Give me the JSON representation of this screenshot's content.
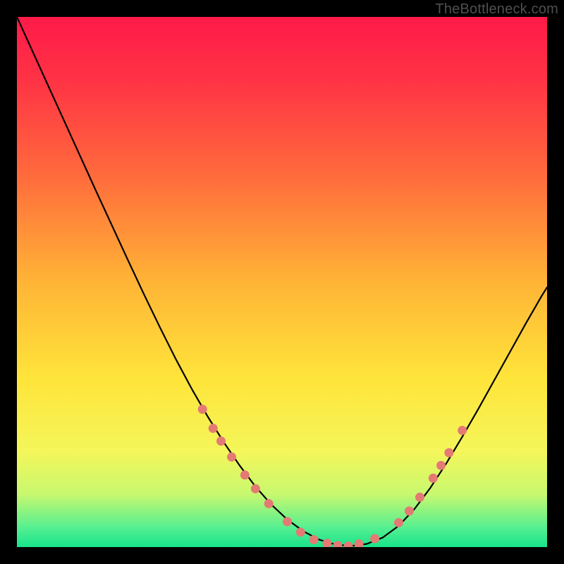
{
  "watermark": "TheBottleneck.com",
  "chart_data": {
    "type": "line",
    "title": "",
    "xlabel": "",
    "ylabel": "",
    "xlim": [
      0,
      100
    ],
    "ylim": [
      0,
      100
    ],
    "grid": false,
    "legend": false,
    "gradient_stops": [
      {
        "offset": 0.0,
        "color": "#ff1a49"
      },
      {
        "offset": 0.12,
        "color": "#ff3345"
      },
      {
        "offset": 0.3,
        "color": "#ff6b3c"
      },
      {
        "offset": 0.5,
        "color": "#ffb436"
      },
      {
        "offset": 0.68,
        "color": "#ffe43a"
      },
      {
        "offset": 0.82,
        "color": "#f4f65a"
      },
      {
        "offset": 0.9,
        "color": "#c8f86f"
      },
      {
        "offset": 0.965,
        "color": "#52ef91"
      },
      {
        "offset": 1.0,
        "color": "#18e38a"
      }
    ],
    "series": [
      {
        "name": "curve",
        "color": "#000000",
        "stroke_width": 2.2,
        "x": [
          0.0,
          3,
          6,
          9,
          12,
          15,
          18,
          21,
          24,
          27,
          30,
          33,
          36,
          39,
          42,
          45,
          48,
          51,
          54,
          57,
          60,
          63,
          66,
          69,
          72,
          75,
          78,
          81,
          84,
          87,
          90,
          93,
          96,
          99,
          100
        ],
        "y": [
          100.0,
          93.4,
          86.8,
          80.2,
          73.6,
          67.0,
          60.5,
          54.0,
          47.6,
          41.4,
          35.4,
          29.8,
          24.6,
          19.8,
          15.4,
          11.4,
          8.0,
          5.2,
          3.0,
          1.4,
          0.5,
          0.2,
          0.6,
          1.8,
          4.0,
          7.2,
          11.2,
          15.8,
          20.8,
          26.0,
          31.4,
          36.8,
          42.2,
          47.4,
          49.0
        ]
      }
    ],
    "markers": {
      "name": "highlight-dots",
      "color": "#e47a74",
      "radius": 6.5,
      "points": [
        {
          "x": 35.0,
          "y": 26.0
        },
        {
          "x": 37.0,
          "y": 22.4
        },
        {
          "x": 38.5,
          "y": 20.0
        },
        {
          "x": 40.5,
          "y": 17.0
        },
        {
          "x": 43.0,
          "y": 13.6
        },
        {
          "x": 45.0,
          "y": 11.0
        },
        {
          "x": 47.5,
          "y": 8.2
        },
        {
          "x": 51.0,
          "y": 4.8
        },
        {
          "x": 53.5,
          "y": 2.8
        },
        {
          "x": 56.0,
          "y": 1.4
        },
        {
          "x": 58.5,
          "y": 0.7
        },
        {
          "x": 60.5,
          "y": 0.3
        },
        {
          "x": 62.5,
          "y": 0.2
        },
        {
          "x": 64.5,
          "y": 0.6
        },
        {
          "x": 67.5,
          "y": 1.6
        },
        {
          "x": 72.0,
          "y": 4.6
        },
        {
          "x": 74.0,
          "y": 6.8
        },
        {
          "x": 76.0,
          "y": 9.4
        },
        {
          "x": 78.5,
          "y": 13.0
        },
        {
          "x": 80.0,
          "y": 15.4
        },
        {
          "x": 81.5,
          "y": 17.8
        },
        {
          "x": 84.0,
          "y": 22.0
        }
      ]
    }
  }
}
